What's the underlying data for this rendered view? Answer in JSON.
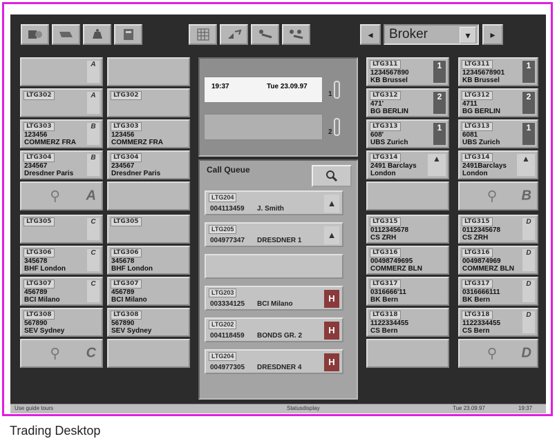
{
  "caption": "Trading Desktop",
  "toolbar": {
    "icons": [
      "phone-book-icon",
      "handset-icon",
      "bell-person-icon",
      "keypad-phone-icon",
      "grid-icon",
      "transfer-icon",
      "forward-icon",
      "conference-icon"
    ],
    "selector_label": "Broker",
    "prev_arrow": "◂",
    "next_arrow": "▸",
    "dropdown_arrow": "▾"
  },
  "col1": [
    {
      "tag": "",
      "l1": "",
      "l2": "",
      "side": "A"
    },
    {
      "tag": "LTG302",
      "l1": "",
      "l2": "",
      "side": "A"
    },
    {
      "tag": "LTG303",
      "l1": "123456",
      "l2": "COMMERZ FRA",
      "side": "B"
    },
    {
      "tag": "LTG304",
      "l1": "234567",
      "l2": "Dresdner Paris",
      "side": "B"
    },
    {
      "tag": "",
      "l1": "",
      "l2": "",
      "big": "A"
    },
    {
      "tag": "LTG305",
      "l1": "",
      "l2": "",
      "side": "C"
    },
    {
      "tag": "LTG306",
      "l1": "345678",
      "l2": "BHF London",
      "side": "C"
    },
    {
      "tag": "LTG307",
      "l1": "456789",
      "l2": "BCI Milano",
      "side": "C"
    },
    {
      "tag": "LTG308",
      "l1": "567890",
      "l2": "SEV Sydney",
      "side": ""
    },
    {
      "tag": "",
      "l1": "",
      "l2": "",
      "big": "C"
    }
  ],
  "col2": [
    {
      "tag": "",
      "l1": "",
      "l2": ""
    },
    {
      "tag": "LTG302",
      "l1": "",
      "l2": ""
    },
    {
      "tag": "LTG303",
      "l1": "123456",
      "l2": "COMMERZ FRA"
    },
    {
      "tag": "LTG304",
      "l1": "234567",
      "l2": "Dresdner Paris"
    },
    {
      "tag": "",
      "l1": "",
      "l2": ""
    },
    {
      "tag": "LTG305",
      "l1": "",
      "l2": ""
    },
    {
      "tag": "LTG306",
      "l1": "345678",
      "l2": "BHF London"
    },
    {
      "tag": "LTG307",
      "l1": "456789",
      "l2": "BCI Milano"
    },
    {
      "tag": "LTG308",
      "l1": "567890",
      "l2": "SEV Sydney"
    },
    {
      "tag": "",
      "l1": "",
      "l2": ""
    }
  ],
  "col4": [
    {
      "tag": "LTG311",
      "l1": "1234567890",
      "l2": "KB Brussel",
      "side": "1"
    },
    {
      "tag": "LTG312",
      "l1": "471'",
      "l2": "BG BERLIN",
      "side": "2"
    },
    {
      "tag": "LTG313",
      "l1": "608'",
      "l2": "UBS Zurich",
      "side": "1"
    },
    {
      "tag": "LTG314",
      "l1": "2491 Barclays",
      "l2": "London",
      "side": "bell"
    },
    {
      "tag": "",
      "l1": "",
      "l2": ""
    },
    {
      "tag": "LTG315",
      "l1": "0112345678",
      "l2": "CS ZRH",
      "side": ""
    },
    {
      "tag": "LTG316",
      "l1": "00498749695",
      "l2": "COMMERZ BLN",
      "side": ""
    },
    {
      "tag": "LTG317",
      "l1": "0316666'11",
      "l2": "BK Bern",
      "side": ""
    },
    {
      "tag": "LTG318",
      "l1": "1122334455",
      "l2": "CS Bern",
      "side": ""
    },
    {
      "tag": "",
      "l1": "",
      "l2": ""
    }
  ],
  "col5": [
    {
      "tag": "LTG311",
      "l1": "12345678901",
      "l2": "KB Brussel",
      "side": "1"
    },
    {
      "tag": "LTG312",
      "l1": "4711",
      "l2": "BG BERLIN",
      "side": "2"
    },
    {
      "tag": "LTG313",
      "l1": "6081",
      "l2": "UBS Zurich",
      "side": "1"
    },
    {
      "tag": "LTG314",
      "l1": "2491Barclays",
      "l2": "London",
      "side": "bell"
    },
    {
      "tag": "",
      "l1": "",
      "l2": "",
      "big": "B"
    },
    {
      "tag": "LTG315",
      "l1": "0112345678",
      "l2": "CS ZRH",
      "side": "D"
    },
    {
      "tag": "LTG316",
      "l1": "0049874969",
      "l2": "COMMERZ BLN",
      "side": "D"
    },
    {
      "tag": "LTG317",
      "l1": "0316666111",
      "l2": "BK Bern",
      "side": "D"
    },
    {
      "tag": "LTG318",
      "l1": "1122334455",
      "l2": "CS Bern",
      "side": "D"
    },
    {
      "tag": "",
      "l1": "",
      "l2": "",
      "big": "D"
    }
  ],
  "center": {
    "line1_time": "19:37",
    "line1_date": "Tue 23.09.97",
    "line1_index": "1",
    "line2_index": "2",
    "queue_title": "Call Queue",
    "queue": [
      {
        "tag": "LTG204",
        "num": "004113459",
        "name": "J. Smith",
        "icon": "bell"
      },
      {
        "tag": "LTG205",
        "num": "004977347",
        "name": "DRESDNER 1",
        "icon": "bell"
      },
      {
        "tag": "",
        "num": "",
        "name": "",
        "icon": ""
      },
      {
        "tag": "LTG203",
        "num": "003334125",
        "name": "BCI Milano",
        "icon": "H"
      },
      {
        "tag": "LTG202",
        "num": "004118459",
        "name": "BONDS GR. 2",
        "icon": "H"
      },
      {
        "tag": "LTG204",
        "num": "004977305",
        "name": "DRESDNER 4",
        "icon": "H"
      }
    ]
  },
  "status": {
    "left": "Use guide tours",
    "mid": "Statusdisplay",
    "date": "Tue 23.09.97",
    "time": "19:37"
  }
}
